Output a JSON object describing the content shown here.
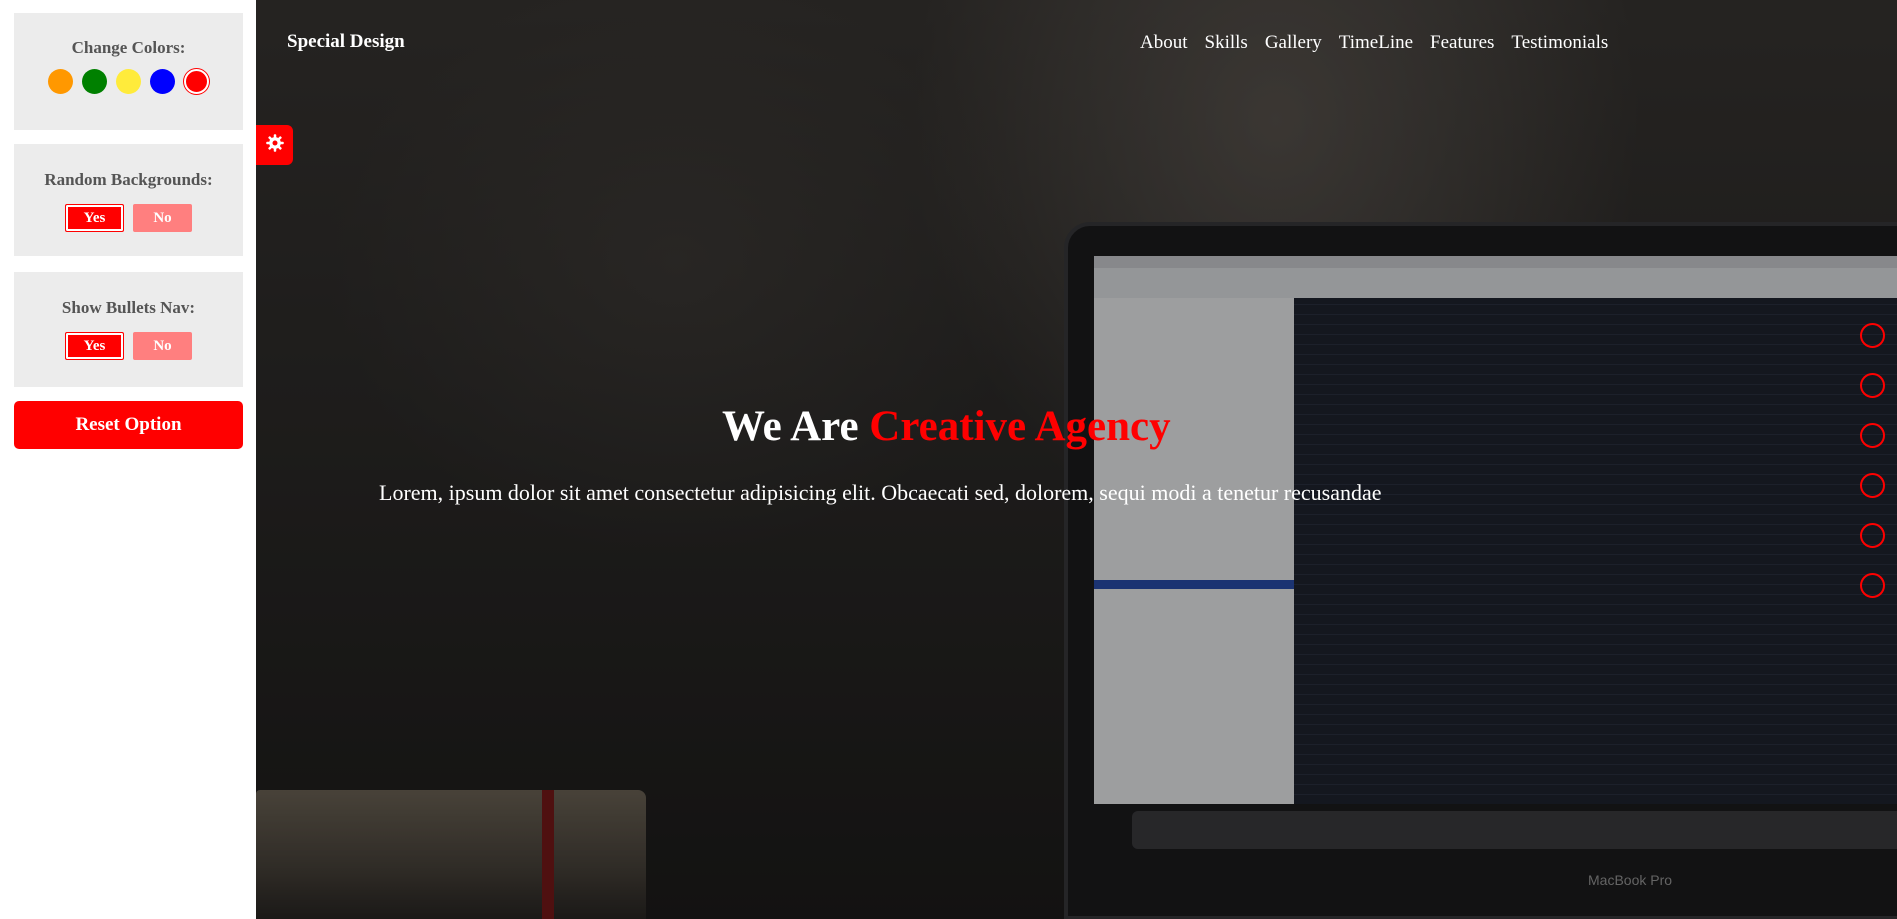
{
  "settings": {
    "change_colors_label": "Change Colors:",
    "colors": [
      "#ff9800",
      "#008000",
      "#ffeb3b",
      "#0000ff",
      "#ff0000"
    ],
    "active_color": "#ff0000",
    "random_backgrounds_label": "Random Backgrounds:",
    "show_bullets_label": "Show Bullets Nav:",
    "yes_label": "Yes",
    "no_label": "No",
    "reset_label": "Reset Option",
    "gear_icon": "gear-icon"
  },
  "header": {
    "logo": "Special Design",
    "nav": [
      "About",
      "Skills",
      "Gallery",
      "TimeLine",
      "Features",
      "Testimonials"
    ]
  },
  "hero": {
    "title_prefix": "We Are ",
    "title_accent": "Creative Agency",
    "description": "Lorem, ipsum dolor sit amet consectetur adipisicing elit. Obcaecati sed, dolorem, sequi modi a tenetur recusandae",
    "laptop_brand": "MacBook Pro"
  },
  "bullets": {
    "count": 6,
    "color": "#ff0000"
  }
}
